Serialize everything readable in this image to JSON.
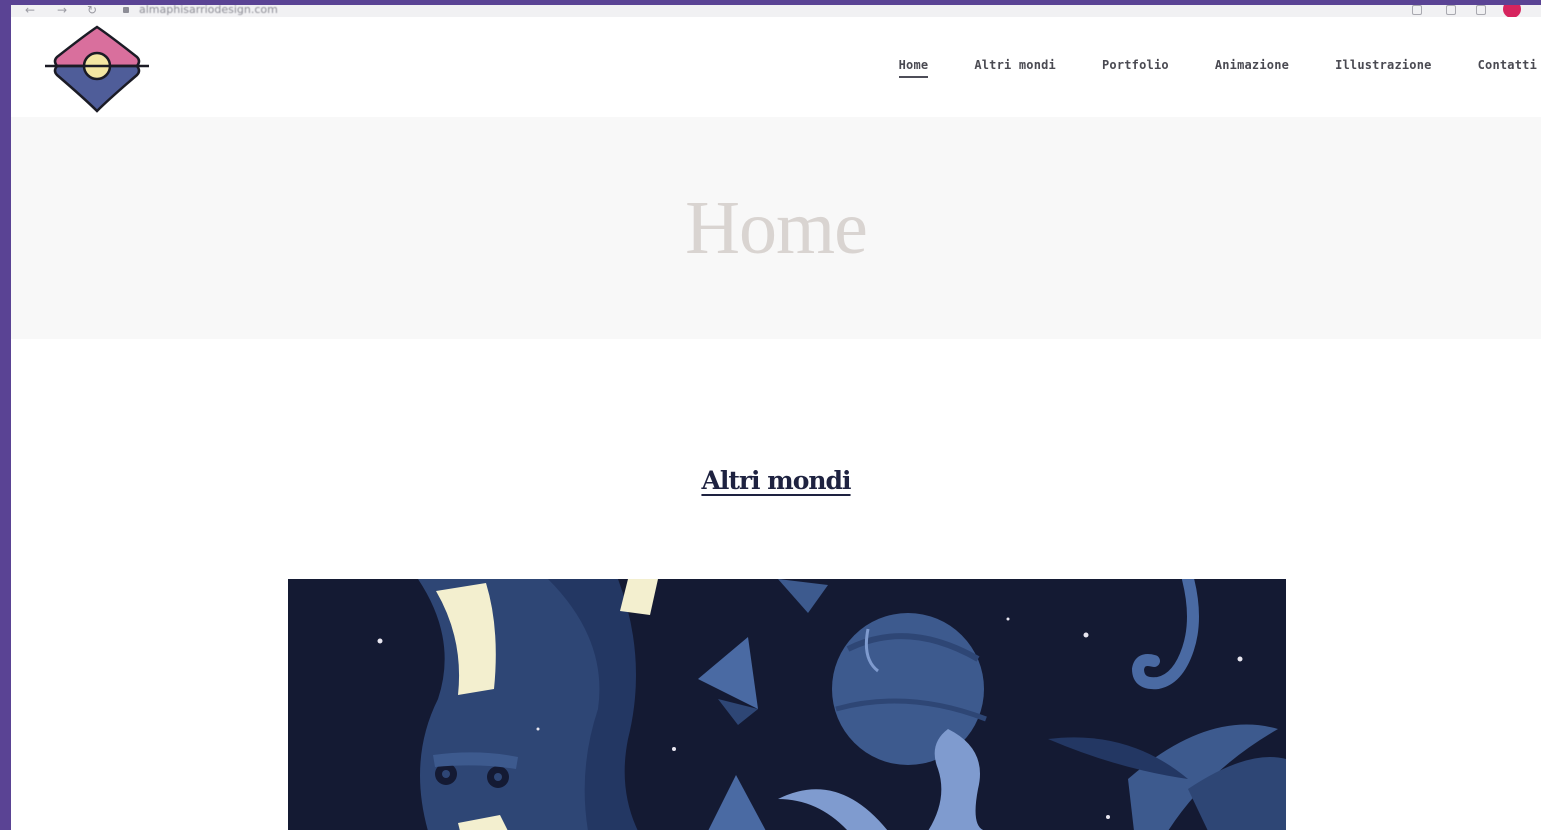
{
  "browser": {
    "url": "almaphisarriodesign.com",
    "back_glyph": "←",
    "forward_glyph": "→",
    "reload_glyph": "↻"
  },
  "header": {
    "nav": [
      {
        "label": "Home",
        "active": true
      },
      {
        "label": "Altri mondi",
        "active": false
      },
      {
        "label": "Portfolio",
        "active": false
      },
      {
        "label": "Animazione",
        "active": false
      },
      {
        "label": "Illustrazione",
        "active": false
      },
      {
        "label": "Contatti",
        "active": false
      }
    ]
  },
  "page": {
    "title": "Home"
  },
  "section": {
    "heading": "Altri mondi"
  },
  "colors": {
    "frame": "#5a4394",
    "logo_pink": "#d96f9d",
    "logo_blue": "#4f5d99",
    "logo_yellow": "#f3e6a2",
    "art_bg": "#141a33",
    "art_cream": "#f3efcf",
    "art_blue": "#3d5a8e"
  }
}
